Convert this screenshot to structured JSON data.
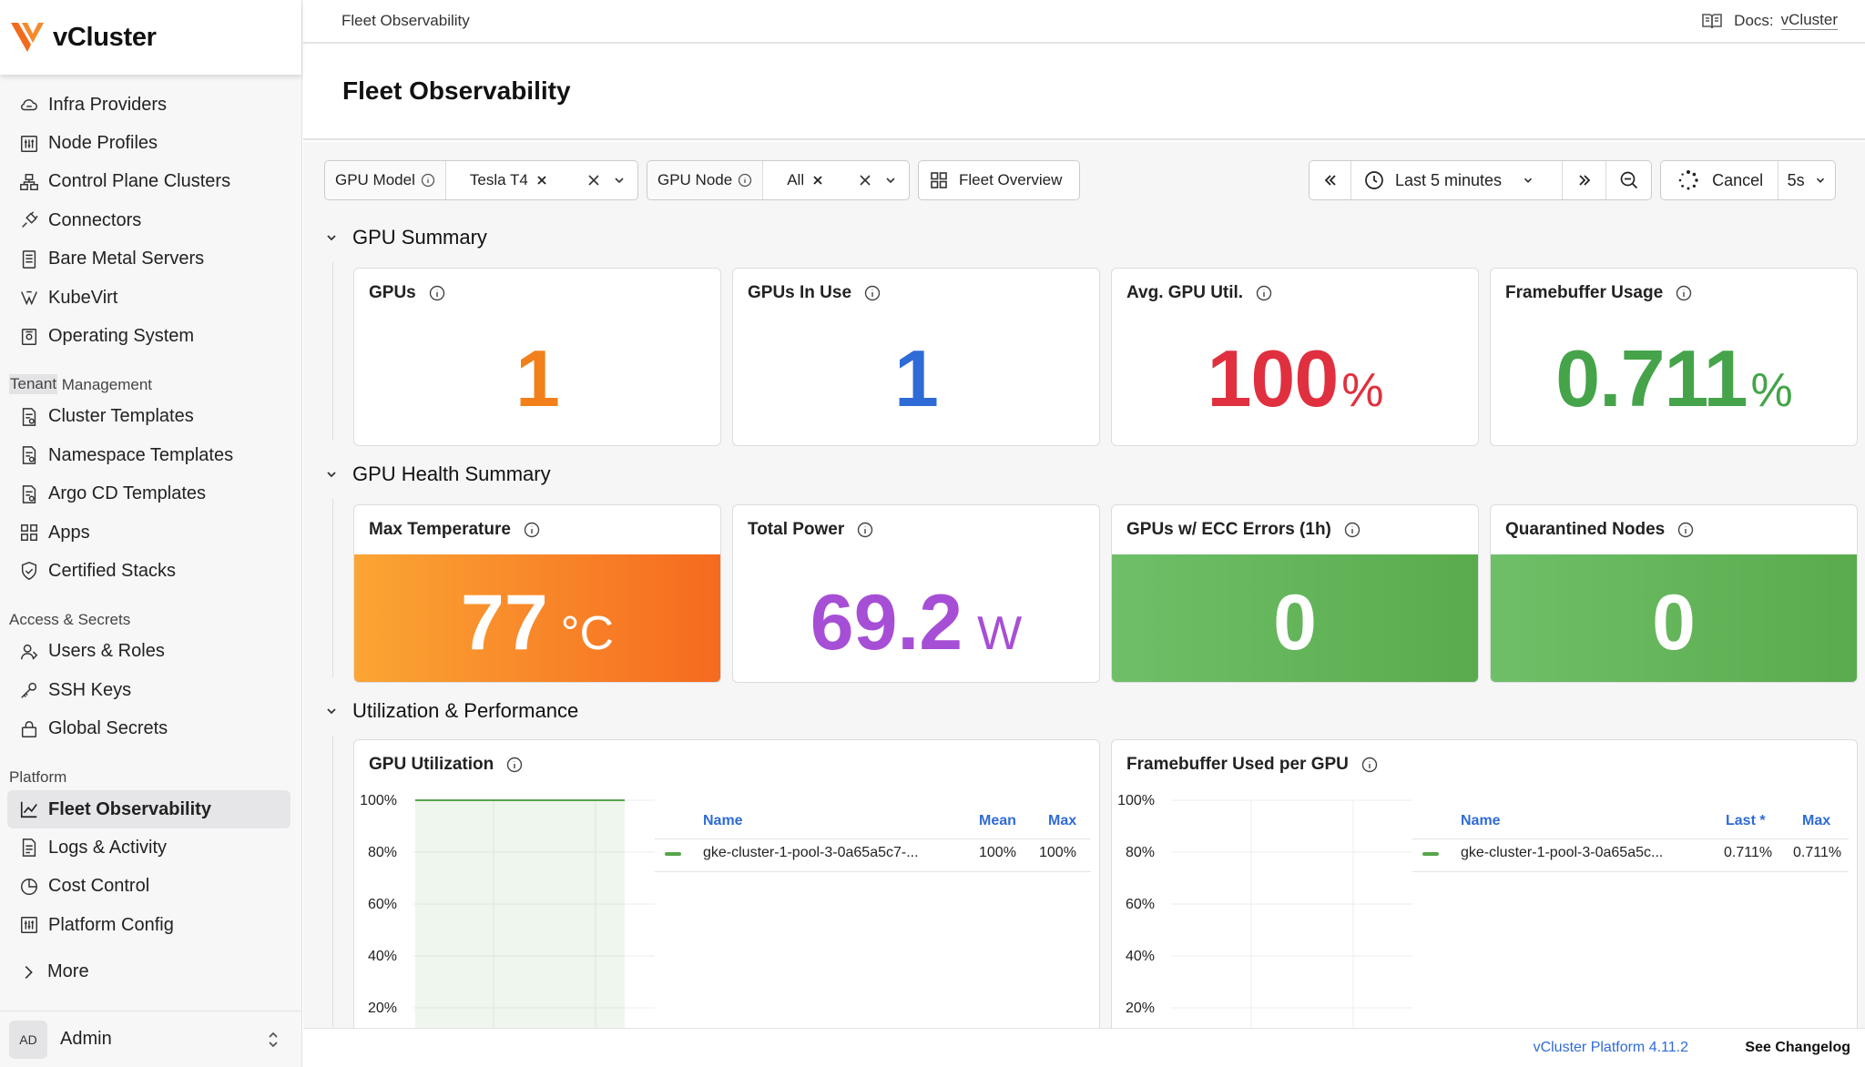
{
  "app": {
    "name": "vCluster"
  },
  "sidebar": {
    "items_top": [
      {
        "label": "Infra Providers",
        "icon": "cloud-icon"
      },
      {
        "label": "Node Profiles",
        "icon": "sliders-icon"
      },
      {
        "label": "Control Plane Clusters",
        "icon": "cluster-icon"
      },
      {
        "label": "Connectors",
        "icon": "plug-icon"
      },
      {
        "label": "Bare Metal Servers",
        "icon": "server-icon"
      },
      {
        "label": "KubeVirt",
        "icon": "kubevirt-icon"
      },
      {
        "label": "Operating System",
        "icon": "disk-icon"
      }
    ],
    "section_tenant": "Tenant",
    "section_tenant_rest": " Management",
    "items_tenant": [
      {
        "label": "Cluster Templates",
        "icon": "template-icon"
      },
      {
        "label": "Namespace Templates",
        "icon": "template-icon"
      },
      {
        "label": "Argo CD Templates",
        "icon": "template-icon"
      },
      {
        "label": "Apps",
        "icon": "apps-grid-icon"
      },
      {
        "label": "Certified Stacks",
        "icon": "shield-check-icon"
      }
    ],
    "section_access": "Access & Secrets",
    "items_access": [
      {
        "label": "Users & Roles",
        "icon": "users-icon"
      },
      {
        "label": "SSH Keys",
        "icon": "key-icon"
      },
      {
        "label": "Global Secrets",
        "icon": "lock-icon"
      }
    ],
    "section_platform": "Platform",
    "items_platform": [
      {
        "label": "Fleet Observability",
        "icon": "chart-line-icon"
      },
      {
        "label": "Logs & Activity",
        "icon": "file-icon"
      },
      {
        "label": "Cost Control",
        "icon": "pie-icon"
      },
      {
        "label": "Platform Config",
        "icon": "sliders-icon"
      }
    ],
    "more": "More",
    "user": {
      "initials": "AD",
      "name": "Admin"
    }
  },
  "topbar": {
    "breadcrumb": "Fleet Observability",
    "docs_label": "Docs:",
    "docs_link": "vCluster"
  },
  "page": {
    "title": "Fleet Observability"
  },
  "filters": {
    "gpu_model_label": "GPU Model",
    "gpu_model_value": "Tesla T4",
    "gpu_node_label": "GPU Node",
    "gpu_node_value": "All",
    "fleet_overview": "Fleet Overview",
    "time_range": "Last 5 minutes",
    "cancel": "Cancel",
    "refresh": "5s"
  },
  "sections": {
    "gpu_summary": "GPU Summary",
    "gpu_health": "GPU Health Summary",
    "utilization": "Utilization & Performance"
  },
  "stats": {
    "gpus": {
      "title": "GPUs",
      "value": "1",
      "color": "#f2801a"
    },
    "gpus_in_use": {
      "title": "GPUs In Use",
      "value": "1",
      "color": "#2f6bd6"
    },
    "avg_util": {
      "title": "Avg. GPU Util.",
      "value": "100",
      "unit": "%",
      "color": "#e0303f"
    },
    "framebuffer": {
      "title": "Framebuffer Usage",
      "value": "0.711",
      "unit": "%",
      "color": "#45a44a"
    },
    "max_temp": {
      "title": "Max Temperature",
      "value": "77",
      "unit": "°C"
    },
    "total_power": {
      "title": "Total Power",
      "value": "69.2",
      "unit": "W",
      "color": "#a64fd6"
    },
    "ecc_errors": {
      "title": "GPUs w/ ECC Errors (1h)",
      "value": "0"
    },
    "quarantined": {
      "title": "Quarantined Nodes",
      "value": "0"
    }
  },
  "panels": {
    "gpu_util": {
      "title": "GPU Utilization",
      "col_name": "Name",
      "col_mean": "Mean",
      "col_max": "Max",
      "row_name": "gke-cluster-1-pool-3-0a65a5c7-...",
      "row_mean": "100%",
      "row_max": "100%"
    },
    "fb_used": {
      "title": "Framebuffer Used per GPU",
      "col_name": "Name",
      "col_last": "Last *",
      "col_max": "Max",
      "row_name": "gke-cluster-1-pool-3-0a65a5c...",
      "row_last": "0.711%",
      "row_max": "0.711%"
    }
  },
  "chart_data": [
    {
      "type": "area",
      "title": "GPU Utilization",
      "y_ticks": [
        "100%",
        "80%",
        "60%",
        "40%",
        "20%"
      ],
      "ylim": [
        20,
        100
      ],
      "series": [
        {
          "name": "gke-cluster-1-pool-3-0a65a5c7-...",
          "values": [
            100,
            100
          ]
        }
      ]
    },
    {
      "type": "line",
      "title": "Framebuffer Used per GPU",
      "y_ticks": [
        "100%",
        "80%",
        "60%",
        "40%",
        "20%"
      ],
      "ylim": [
        20,
        100
      ],
      "series": [
        {
          "name": "gke-cluster-1-pool-3-0a65a5c...",
          "values": [
            0.711,
            0.711
          ]
        }
      ]
    }
  ],
  "footer": {
    "version": "vCluster Platform 4.11.2",
    "changelog": "See Changelog"
  }
}
